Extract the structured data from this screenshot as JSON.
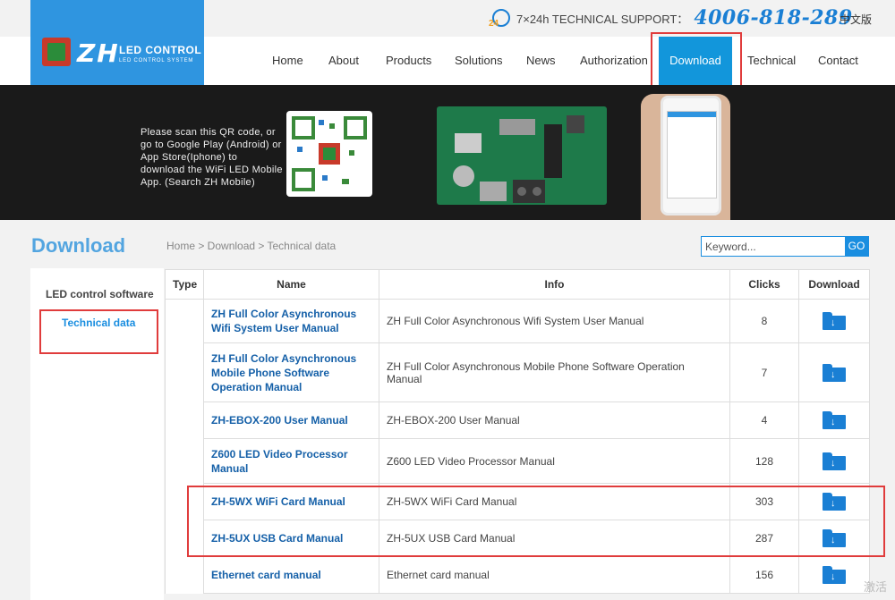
{
  "header": {
    "support_label": "7×24h TECHNICAL SUPPORT：",
    "phone": "4006-818-289",
    "language": "中文版",
    "logo_main": "ZH",
    "logo_led": "LED CONTROL",
    "logo_sub": "LED CONTROL SYSTEM"
  },
  "nav": {
    "home": "Home",
    "about": "About",
    "products": "Products",
    "solutions": "Solutions",
    "news": "News",
    "authorization": "Authorization",
    "download": "Download",
    "technical": "Technical",
    "contact": "Contact"
  },
  "banner": {
    "text": "Please scan this QR code, or go to Google Play (Android) or App Store(Iphone) to download the WiFi LED Mobile App. (Search ZH Mobile)"
  },
  "page": {
    "title": "Download",
    "breadcrumb": "Home > Download > Technical data",
    "search_placeholder": "Keyword...",
    "search_button": "GO"
  },
  "sidebar": {
    "items": [
      {
        "label": "LED control software"
      },
      {
        "label": "Technical data"
      }
    ]
  },
  "table": {
    "headers": [
      "Type",
      "Name",
      "Info",
      "Clicks",
      "Download"
    ],
    "rows": [
      {
        "name": "ZH Full Color Asynchronous Wifi System User Manual",
        "info": "ZH Full Color Asynchronous Wifi System User Manual",
        "clicks": "8"
      },
      {
        "name": "ZH Full Color Asynchronous Mobile Phone Software Operation Manual",
        "info": "ZH Full Color Asynchronous Mobile Phone Software Operation Manual",
        "clicks": "7"
      },
      {
        "name": "ZH-EBOX-200 User Manual",
        "info": "ZH-EBOX-200 User Manual",
        "clicks": "4"
      },
      {
        "name": "Z600 LED Video Processor Manual",
        "info": "Z600 LED Video Processor Manual",
        "clicks": "128"
      },
      {
        "name": "ZH-5WX WiFi Card Manual",
        "info": "ZH-5WX WiFi Card Manual",
        "clicks": "303"
      },
      {
        "name": "ZH-5UX USB Card Manual",
        "info": "ZH-5UX USB Card Manual",
        "clicks": "287"
      },
      {
        "name": "Ethernet card manual",
        "info": "Ethernet card manual",
        "clicks": "156"
      }
    ]
  },
  "watermark": "激活",
  "colors": {
    "accent": "#1296db",
    "highlight": "#e03c3c",
    "link": "#1560a8"
  }
}
